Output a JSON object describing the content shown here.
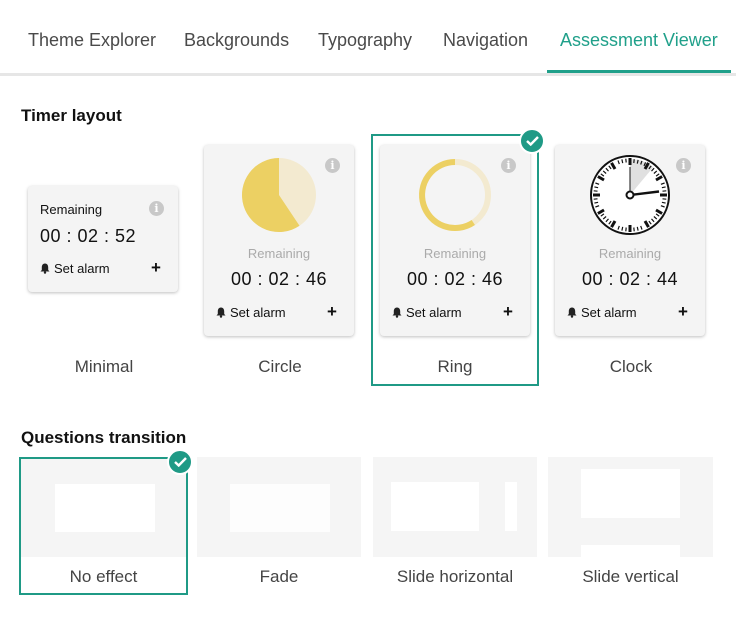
{
  "tabs": [
    {
      "label": "Theme Explorer",
      "active": false
    },
    {
      "label": "Backgrounds",
      "active": false
    },
    {
      "label": "Typography",
      "active": false
    },
    {
      "label": "Navigation",
      "active": false
    },
    {
      "label": "Assessment Viewer",
      "active": true
    }
  ],
  "accent_color": "#1f9a86",
  "timer_section": {
    "title": "Timer layout",
    "options": [
      {
        "label": "Minimal",
        "remaining_label": "Remaining",
        "time": "00 : 02 : 52",
        "alarm_label": "Set alarm",
        "selected": false
      },
      {
        "label": "Circle",
        "remaining_label": "Remaining",
        "time": "00 : 02 : 46",
        "alarm_label": "Set alarm",
        "selected": false,
        "progress_elapsed": 0.41
      },
      {
        "label": "Ring",
        "remaining_label": "Remaining",
        "time": "00 : 02 : 46",
        "alarm_label": "Set alarm",
        "selected": true,
        "progress_elapsed": 0.41
      },
      {
        "label": "Clock",
        "remaining_label": "Remaining",
        "time": "00 : 02 : 44",
        "alarm_label": "Set alarm",
        "selected": false
      }
    ],
    "timer_color": "#ecd063",
    "timer_track_color": "#f3ead0"
  },
  "transition_section": {
    "title": "Questions transition",
    "options": [
      {
        "label": "No effect",
        "selected": true
      },
      {
        "label": "Fade",
        "selected": false
      },
      {
        "label": "Slide horizontal",
        "selected": false
      },
      {
        "label": "Slide vertical",
        "selected": false
      }
    ]
  }
}
